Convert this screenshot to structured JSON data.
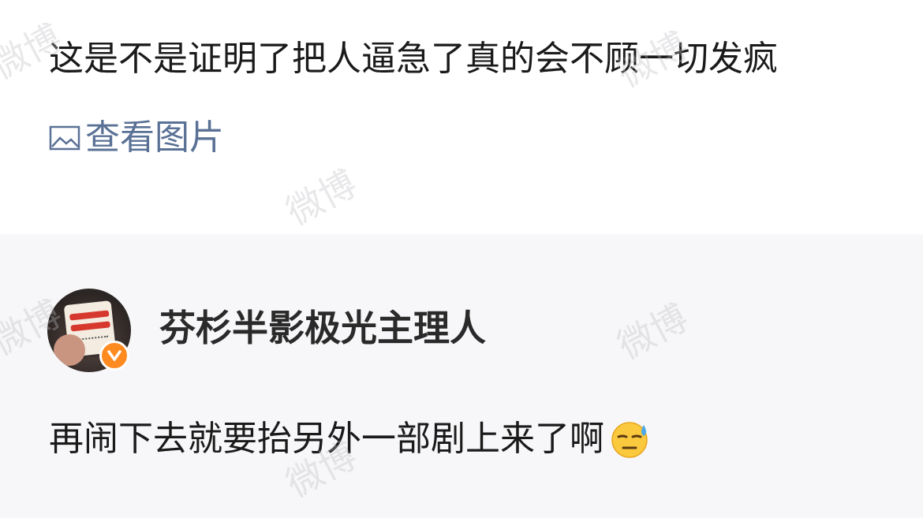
{
  "post": {
    "text": "这是不是证明了把人逼急了真的会不顾一切发疯",
    "view_images_label": "查看图片"
  },
  "comment": {
    "username": "芬杉半影极光主理人",
    "text": "再闹下去就要抬另外一部剧上来了啊",
    "emoji": "sweat-face-emoji",
    "avatar_card_text": "你迟早是个富婆"
  },
  "watermark": "微博",
  "colors": {
    "link": "#5a7196",
    "badge": "#ff8a1f",
    "comment_bg": "#f7f7f9"
  }
}
